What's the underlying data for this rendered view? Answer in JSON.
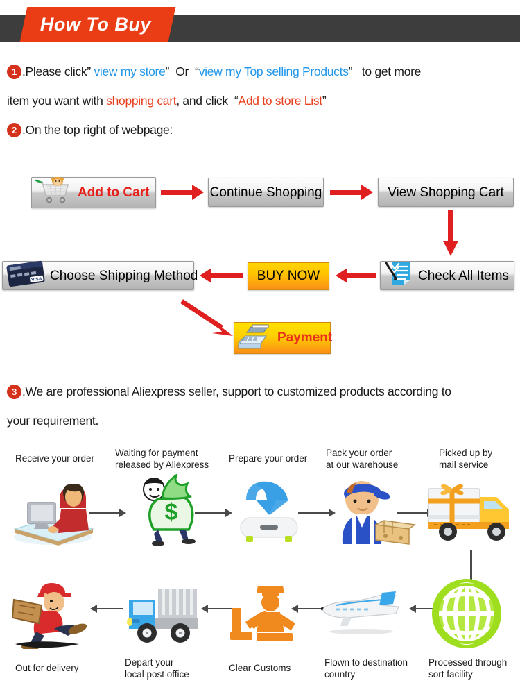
{
  "header": {
    "title": "How To Buy",
    "bar_color": "#3d3d3d",
    "banner_color": "#ea3c15"
  },
  "steps": {
    "step1": {
      "number": "1",
      "t1": ".Please click",
      "q1": "”",
      "link1": "view my store",
      "q2": "”",
      "t2": "Or",
      "q3": "“",
      "link2": "view my Top selling Products",
      "q4": "”",
      "t3": "to get more",
      "t4": "item you want with",
      "highlight1": "shopping cart",
      "t5": ", and click",
      "q5": "“",
      "highlight2": "Add to store List",
      "q6": "”"
    },
    "step2": {
      "number": "2",
      "text": ".On the top right of webpage:"
    },
    "step3": {
      "number": "3",
      "line1": ".We are professional Aliexpress seller, support to customized products according to",
      "line2": "your requirement."
    }
  },
  "buttons": {
    "add_to_cart": "Add to Cart",
    "continue_shopping": "Continue Shopping",
    "view_shopping_cart": "View Shopping Cart",
    "choose_shipping_method": "Choose Shipping Method",
    "buy_now": "BUY NOW",
    "check_all_items": "Check All Items",
    "payment": "Payment"
  },
  "colors": {
    "accent_red": "#e8401f",
    "link_blue": "#2196e8",
    "number_badge": "#d4321a",
    "arrow_red": "#e02020",
    "buy_now_gradient_start": "#ffd400",
    "buy_now_gradient_end": "#fb8f18"
  },
  "shipping_flow": {
    "row1": [
      {
        "label": "Receive your order",
        "icon": "person-at-computer-icon"
      },
      {
        "label": "Waiting for payment\nreleased by Aliexpress",
        "icon": "money-bag-icon"
      },
      {
        "label": "Prepare your order",
        "icon": "download-box-icon"
      },
      {
        "label": "Pack your order\nat our warehouse",
        "icon": "worker-packing-icon"
      },
      {
        "label": "Picked up by\nmail service",
        "icon": "delivery-truck-gift-icon"
      }
    ],
    "row2": [
      {
        "label": "Out for delivery",
        "icon": "courier-running-icon"
      },
      {
        "label": "Depart your\nlocal post office",
        "icon": "blue-post-truck-icon"
      },
      {
        "label": "Clear Customs",
        "icon": "customs-officer-icon"
      },
      {
        "label": "Flown to destination\ncountry",
        "icon": "airplane-icon"
      },
      {
        "label": "Processed through\nsort facility",
        "icon": "green-globe-icon"
      }
    ]
  }
}
